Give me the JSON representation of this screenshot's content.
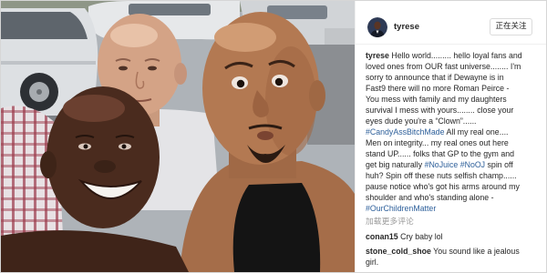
{
  "post": {
    "author": {
      "username": "tyrese"
    },
    "follow_button_label": "正在关注",
    "caption_lines": [
      [
        {
          "user": "tyrese"
        },
        {
          "text": " Hello world......... hello loyal fans and"
        }
      ],
      [
        {
          "text": "loved ones from OUR fast universe........ I'm"
        }
      ],
      [
        {
          "text": "sorry to announce that if Dewayne is in"
        }
      ],
      [
        {
          "text": "Fast9 there will no more Roman Peirce -"
        }
      ],
      [
        {
          "text": "You mess with family and my daughters"
        }
      ],
      [
        {
          "text": "survival I mess with yours........ close your"
        }
      ],
      [
        {
          "text": "eyes dude you're a “Clown”......"
        }
      ],
      [
        {
          "tag": "#CandyAssBitchMade"
        },
        {
          "text": " All my real one...."
        }
      ],
      [
        {
          "text": "Men on integrity... my real ones out here"
        }
      ],
      [
        {
          "text": "stand UP...... folks that GP to the gym and"
        }
      ],
      [
        {
          "text": "get big naturally "
        },
        {
          "tag": "#NoJuice"
        },
        {
          "text": " "
        },
        {
          "tag": "#NoOJ"
        },
        {
          "text": " spin off"
        }
      ],
      [
        {
          "text": "huh? Spin off these nuts selfish champ......"
        }
      ],
      [
        {
          "text": "pause notice who's got his arms around my"
        }
      ],
      [
        {
          "text": "shoulder and who's standing alone -"
        }
      ],
      [
        {
          "tag": "#OurChildrenMatter"
        }
      ]
    ],
    "load_more_comments_label": "加载更多评论",
    "comments": [
      {
        "lines": [
          [
            {
              "user": "conan15"
            },
            {
              "text": " Cry baby lol"
            }
          ]
        ]
      },
      {
        "lines": [
          [
            {
              "user": "stone_cold_shoe"
            },
            {
              "text": " You sound like a jealous"
            }
          ],
          [
            {
              "text": "girl."
            }
          ]
        ]
      }
    ]
  },
  "colors": {
    "text": "#262626",
    "hashtag": "#2d5f9a",
    "muted": "#999999",
    "border": "#dbdbdb"
  }
}
